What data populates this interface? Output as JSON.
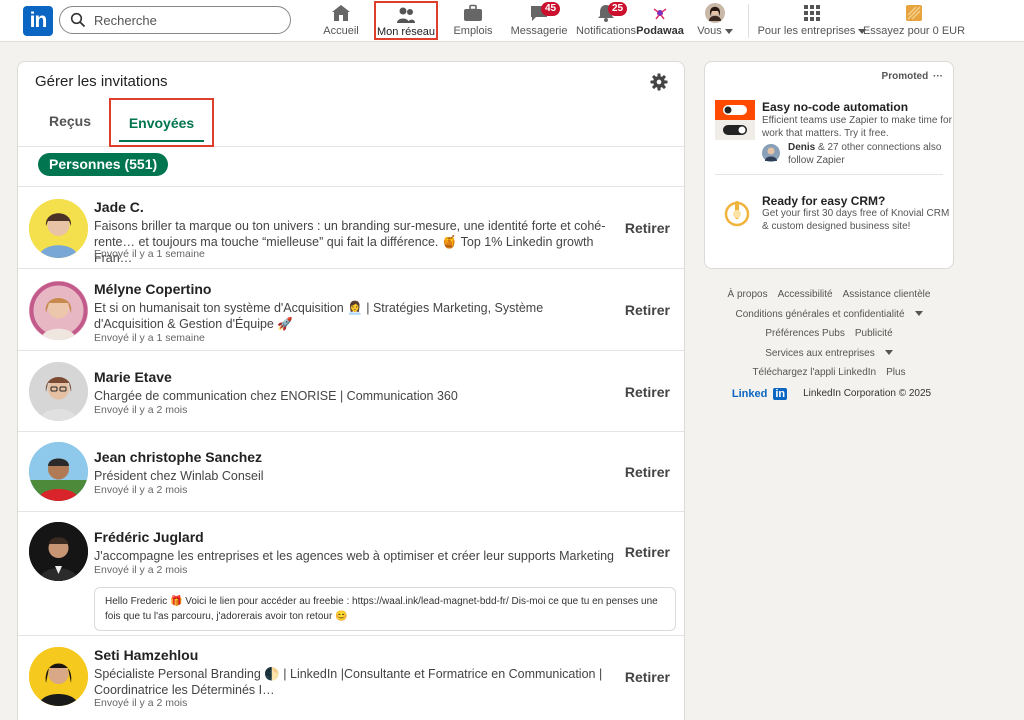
{
  "header": {
    "logo_text": "in",
    "search_placeholder": "Recherche",
    "nav": [
      {
        "label": "Accueil",
        "icon": "home-icon"
      },
      {
        "label": "Mon réseau",
        "icon": "network-icon"
      },
      {
        "label": "Emplois",
        "icon": "briefcase-icon"
      },
      {
        "label": "Messagerie",
        "icon": "message-icon",
        "badge": "45"
      },
      {
        "label": "Notifications",
        "icon": "bell-icon",
        "badge": "25"
      },
      {
        "label": "Podawaa",
        "icon": "podawaa-icon"
      },
      {
        "label": "Vous",
        "icon": "avatar-icon"
      },
      {
        "label": "Pour les entreprises",
        "icon": "grid-icon"
      },
      {
        "label": "Essayez pour 0 EUR",
        "icon": "premium-icon"
      }
    ]
  },
  "invitations": {
    "title": "Gérer les invitations",
    "tab_received": "Reçus",
    "tab_sent": "Envoyées",
    "filter_pill": "Personnes (551)",
    "action_label": "Retirer",
    "rows": [
      {
        "name": "Jade C.",
        "headline": "Faisons briller ta marque ou ton univers : un branding sur-mesure, une identité forte et cohé-rente… et toujours ma touche “mielleuse” qui fait la différence. 🍯 Top 1% Linkedin growth Fran…",
        "sent": "Envoyé il y a 1 semaine"
      },
      {
        "name": "Mélyne Copertino",
        "headline": "Et si on humanisait ton système d'Acquisition 👩‍💼 | Stratégies Marketing, Système d'Acquisition & Gestion d'Équipe 🚀",
        "sent": "Envoyé il y a 1 semaine"
      },
      {
        "name": "Marie Etave",
        "headline": "Chargée de communication chez ENORISE | Communication 360",
        "sent": "Envoyé il y a 2 mois"
      },
      {
        "name": "Jean christophe Sanchez",
        "headline": "Président chez Winlab Conseil",
        "sent": "Envoyé il y a 2 mois"
      },
      {
        "name": "Frédéric Juglard",
        "headline": "J'accompagne les entreprises et les agences web à optimiser et créer leur supports Marketing",
        "sent": "Envoyé il y a 2 mois",
        "message": "Hello Frederic 🎁 Voici le lien pour accéder au freebie : https://waal.ink/lead-magnet-bdd-fr/ Dis-moi ce que tu en penses une fois que tu l'as parcouru, j'adorerais avoir ton retour 😊"
      },
      {
        "name": "Seti Hamzehlou",
        "headline": "Spécialiste Personal Branding 🌓 | LinkedIn |Consultante et Formatrice en Communication | Coordinatrice les Déterminés I…",
        "sent": "Envoyé il y a 2 mois"
      }
    ]
  },
  "ads": {
    "promoted": "Promoted",
    "more": "···",
    "ad1_title": "Easy no-code automation",
    "ad1_desc": "Efficient teams use Zapier to make time for work that matters. Try it free.",
    "ad1_social_name": "Denis",
    "ad1_social_rest": " & 27 other connections also follow Zapier",
    "ad2_title": "Ready for easy CRM?",
    "ad2_desc": "Get your first 30 days free of Knovial CRM & custom designed business site!"
  },
  "footer": {
    "links1": [
      "À propos",
      "Accessibilité",
      "Assistance clientèle"
    ],
    "links2": "Conditions générales et confidentialité",
    "links3": [
      "Préférences Pubs",
      "Publicité"
    ],
    "links4": "Services aux entreprises",
    "links5": [
      "Téléchargez l'appli LinkedIn",
      "Plus"
    ],
    "brand": "Linked",
    "brand_in": "in",
    "copyright": "LinkedIn Corporation © 2025"
  },
  "colors": {
    "brand": "#0a66c2",
    "accent_green": "#01754f",
    "badge_red": "#cb112d",
    "highlight": "#e03e2d"
  }
}
